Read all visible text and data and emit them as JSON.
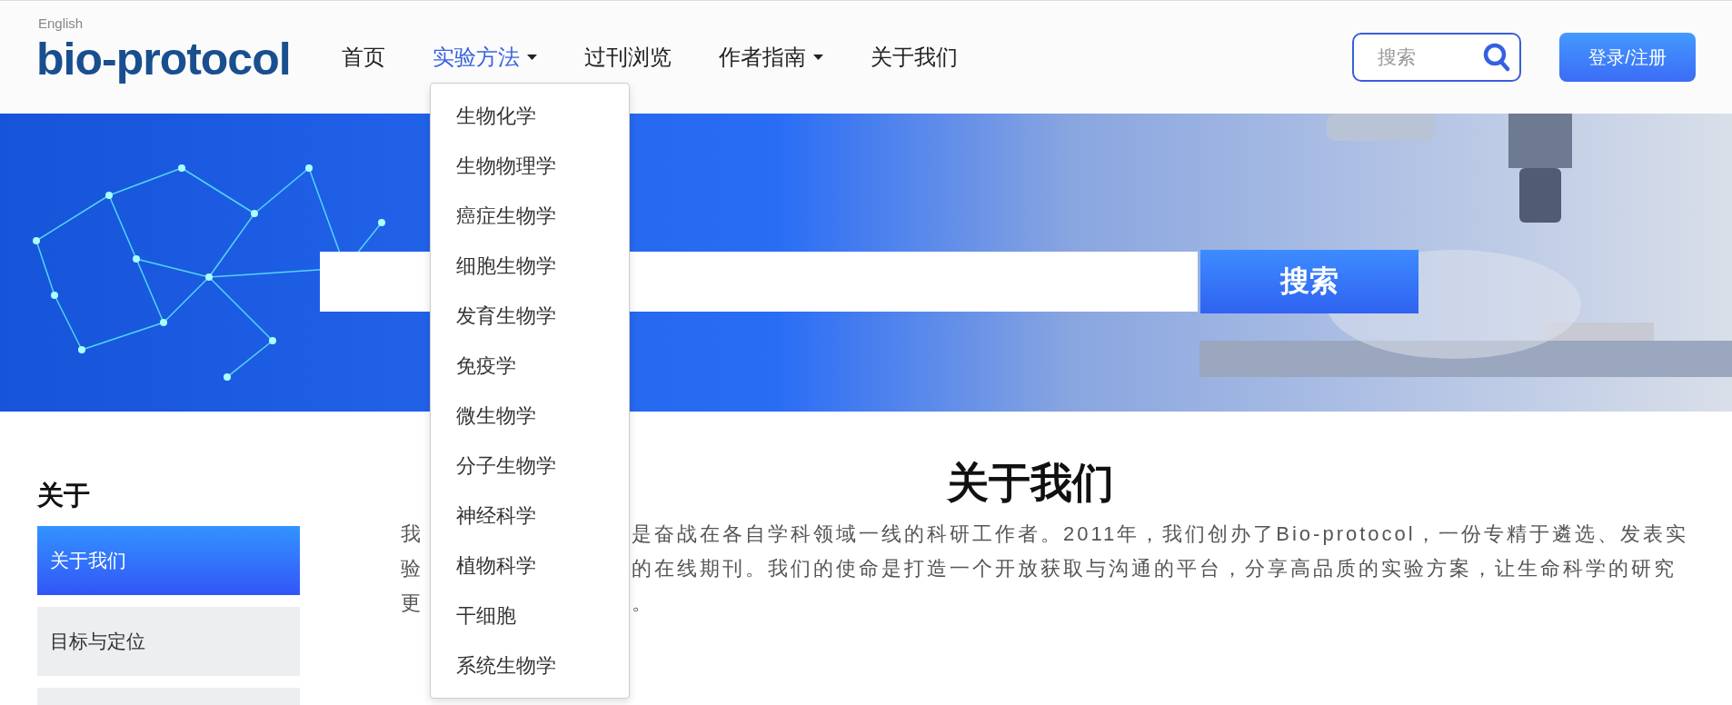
{
  "header": {
    "language_link": "English",
    "logo": "bio-protocol",
    "nav": [
      {
        "label": "首页",
        "selected": false,
        "dropdown": false
      },
      {
        "label": "实验方法",
        "selected": true,
        "dropdown": true
      },
      {
        "label": "过刊浏览",
        "selected": false,
        "dropdown": false
      },
      {
        "label": "作者指南",
        "selected": false,
        "dropdown": true
      },
      {
        "label": "关于我们",
        "selected": false,
        "dropdown": false
      }
    ],
    "search": {
      "placeholder": "搜索"
    },
    "login_button": "登录/注册"
  },
  "banner": {
    "kind": "picture",
    "search_button": "搜索"
  },
  "method_menu": {
    "items": [
      "生物化学",
      "生物物理学",
      "癌症生物学",
      "细胞生物学",
      "发育生物学",
      "免疫学",
      "微生物学",
      "分子生物学",
      "神经科学",
      "植物科学",
      "干细胞",
      "系统生物学"
    ]
  },
  "sidebar": {
    "title": "关于",
    "items": [
      {
        "label": "关于我们",
        "selected": true
      },
      {
        "label": "目标与定位",
        "selected": false
      },
      {
        "selected": false
      }
    ]
  },
  "content": {
    "title": "关于我们",
    "lines": [
      {
        "left": "我",
        "right": "是奋战在各自学科领域一线的科研工作者。2011年，我们创办了Bio-protocol，一份专精于遴选、发表实"
      },
      {
        "left": "验",
        "right": "的在线期刊。我们的使命是打造一个开放获取与沟通的平台，分享高品质的实验方案，让生命科学的研究"
      },
      {
        "left": "更",
        "right": "。"
      }
    ]
  }
}
